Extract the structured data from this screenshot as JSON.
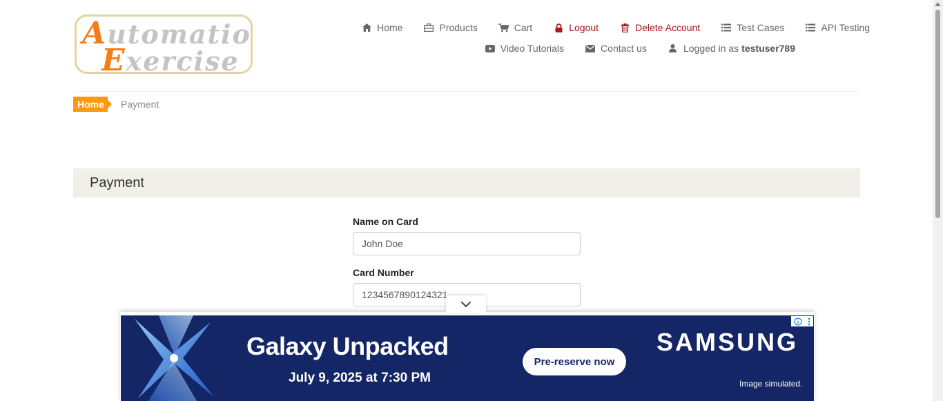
{
  "logo": {
    "line1_cap": "A",
    "line1_rest": "utomation",
    "line2_cap": "E",
    "line2_rest": "xercise"
  },
  "nav": {
    "row1": [
      {
        "label": "Home",
        "icon": "home-icon"
      },
      {
        "label": "Products",
        "icon": "briefcase-icon"
      },
      {
        "label": "Cart",
        "icon": "cart-icon"
      },
      {
        "label": "Logout",
        "icon": "lock-icon"
      },
      {
        "label": "Delete Account",
        "icon": "trash-icon"
      },
      {
        "label": "Test Cases",
        "icon": "list-icon"
      },
      {
        "label": "API Testing",
        "icon": "list-icon"
      }
    ],
    "row2": [
      {
        "label": "Video Tutorials",
        "icon": "youtube-icon"
      },
      {
        "label": "Contact us",
        "icon": "envelope-icon"
      }
    ],
    "logged_in_prefix": "Logged in as",
    "username": "testuser789"
  },
  "breadcrumb": {
    "home": "Home",
    "current": "Payment"
  },
  "payment": {
    "heading": "Payment",
    "name_label": "Name on Card",
    "name_value": "John Doe",
    "card_label": "Card Number",
    "card_value": "1234567890124321"
  },
  "ad": {
    "title": "Galaxy Unpacked",
    "date": "July 9, 2025 at 7:30 PM",
    "cta": "Pre-reserve now",
    "brand": "SAMSUNG",
    "note": "Image simulated.",
    "bg_color": "#142666"
  },
  "colors": {
    "accent": "#fe980f",
    "danger": "#a51a1a",
    "heading_bg": "#f0efe8"
  }
}
